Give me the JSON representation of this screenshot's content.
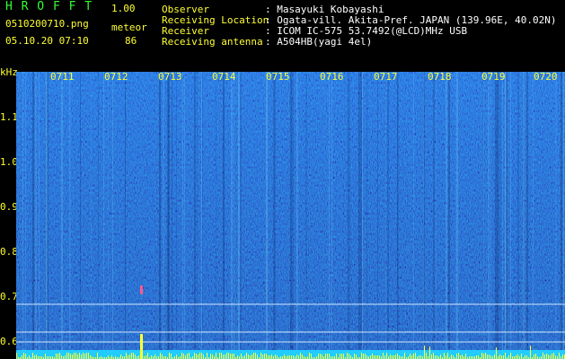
{
  "header": {
    "app_title": "H R O F F T",
    "version": "1.00",
    "filename": "0510200710.png",
    "datetime": "05.10.20 07:10",
    "meteor_label": "meteor",
    "meteor_count": "86"
  },
  "station": {
    "observer_label": "Observer",
    "observer_value": ": Masayuki Kobayashi",
    "location_label": "Receiving Location",
    "location_value": ": Ogata-vill. Akita-Pref. JAPAN (139.96E, 40.02N)",
    "receiver_label": "Receiver",
    "receiver_value": ": ICOM IC-575 53.7492(@LCD)MHz USB",
    "antenna_label": "Receiving antenna",
    "antenna_value": ": A504HB(yagi 4el)"
  },
  "plot": {
    "y_unit": "kHz",
    "y_ticks": [
      "1.1",
      "1.0",
      "0.9",
      "0.8",
      "0.7",
      "0.6"
    ],
    "time_ticks": [
      "0711",
      "0712",
      "0713",
      "0714",
      "0715",
      "0716",
      "0717",
      "0718",
      "0719",
      "0720"
    ]
  },
  "colors": {
    "label_green": "#33ff33",
    "value_yellow": "#ffff33",
    "spectrum_bg": "#0a1a9e"
  }
}
